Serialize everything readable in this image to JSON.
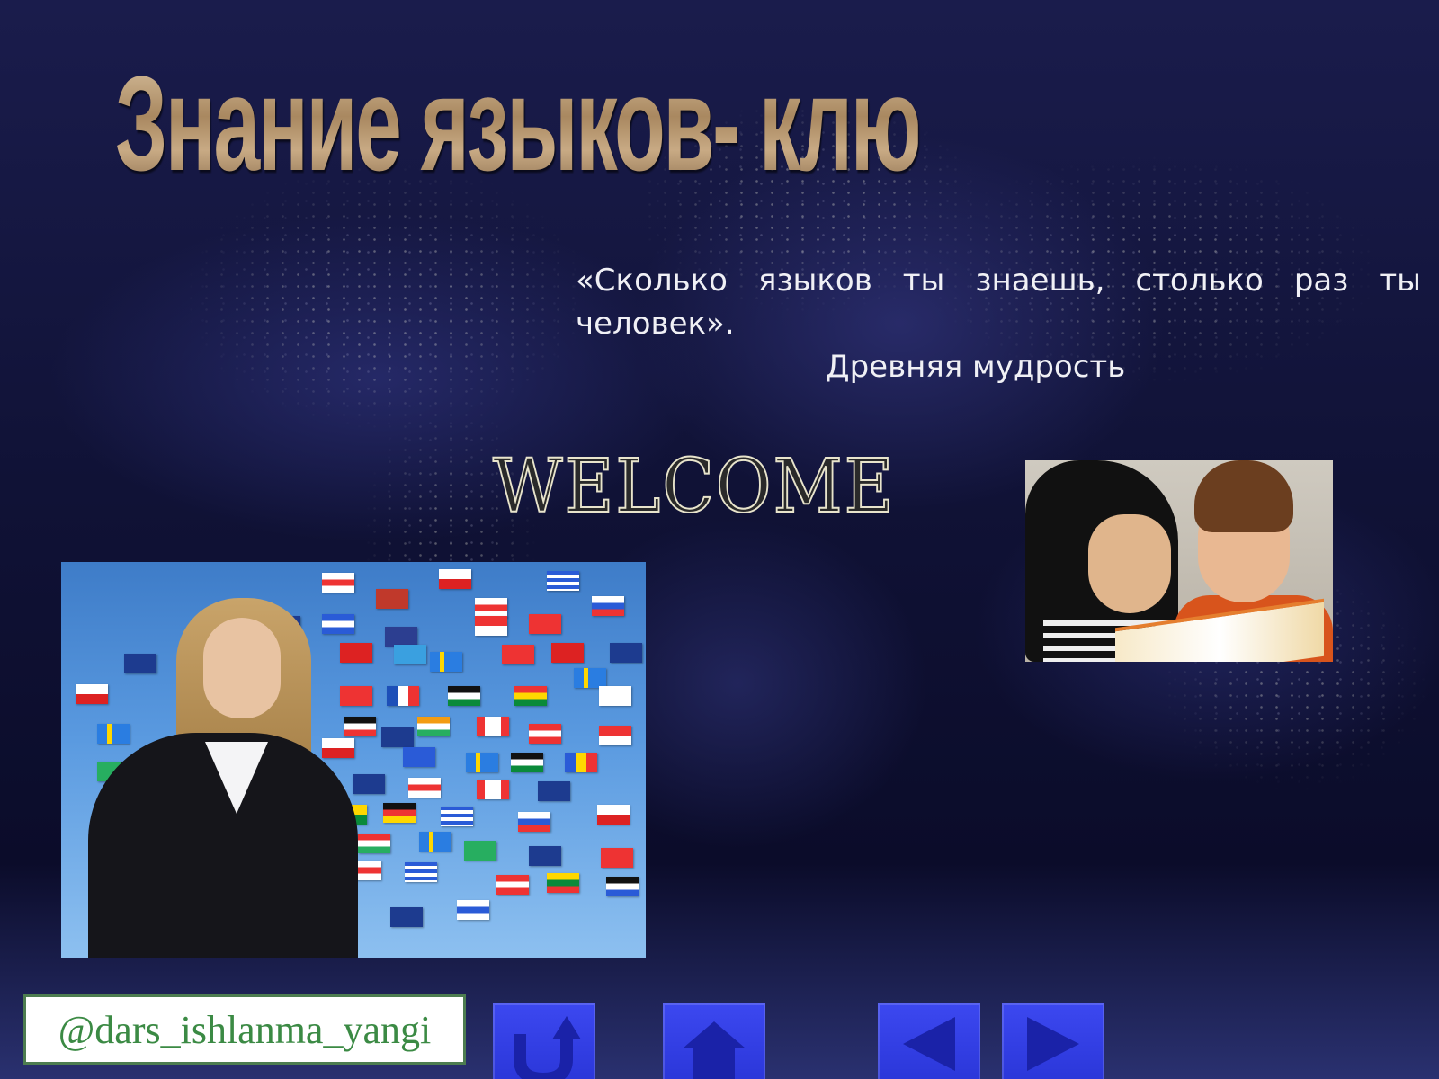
{
  "slide": {
    "title": "Знание языков-  ключ к успеху",
    "quote": {
      "text": "«Сколько языков ты знаешь, столько раз ты человек».",
      "author": "Древняя мудрость"
    },
    "welcome": "WELCOME",
    "watermark": "@dars_ishlanma_yangi"
  },
  "images": {
    "left": "woman-with-flags-photo",
    "right": "children-reading-photo"
  },
  "navigation": [
    {
      "name": "return",
      "icon": "return-arrow-icon"
    },
    {
      "name": "home",
      "icon": "home-icon"
    },
    {
      "name": "previous",
      "icon": "triangle-left-icon"
    },
    {
      "name": "next",
      "icon": "triangle-right-icon"
    }
  ],
  "colors": {
    "background": "#0a0b2e",
    "title": "#b89a78",
    "button": "#2a36d8",
    "watermark_text": "#3b8a44"
  }
}
